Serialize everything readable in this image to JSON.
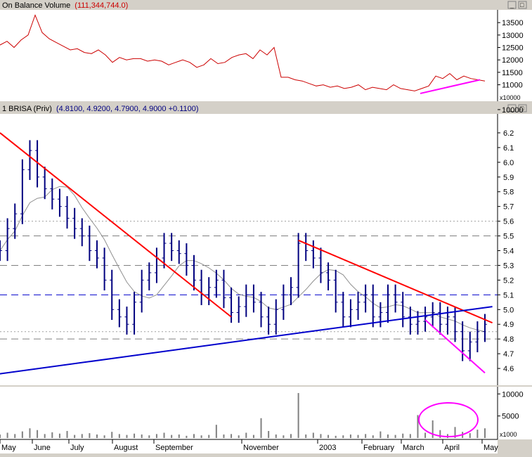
{
  "obv_panel": {
    "title": "On Balance Volume",
    "value": "(111,344,744.0)",
    "multiplier": "x10000"
  },
  "price_panel": {
    "title": "1 BRISA (Priv)",
    "values": "(4.8100, 4.9200, 4.7900, 4.9000 +0.1100)"
  },
  "volume_panel": {
    "multiplier": "x1000"
  },
  "window_buttons": {
    "minimize": "_",
    "maximize": "□"
  },
  "colors": {
    "background": "#ffffff",
    "frame": "#d4d0c8",
    "price_bars": "#00007f",
    "obv_line": "#cc0000",
    "down_trendline": "#ff0000",
    "up_trendline": "#0000cc",
    "divergence_marks": "#ff00ff",
    "title_blue": "#000080",
    "title_red": "#cc0000"
  },
  "chart_data": [
    {
      "type": "line",
      "name": "On Balance Volume",
      "y_axis_ticks": [
        13500,
        13000,
        12500,
        12000,
        11500,
        11000,
        10000
      ],
      "ylim": [
        10450,
        13900
      ],
      "series": [
        {
          "values": [
            12600,
            12750,
            12500,
            12800,
            13000,
            13800,
            13100,
            12850,
            12700,
            12550,
            12400,
            12450,
            12300,
            12250,
            12400,
            12200,
            11900,
            12100,
            12000,
            12050,
            12050,
            11950,
            12000,
            11950,
            11800,
            11900,
            12000,
            11900,
            11700,
            11800,
            12050,
            11850,
            11900,
            12100,
            12200,
            12250,
            12050,
            12400,
            12200,
            12500,
            11300,
            11300,
            11200,
            11150,
            11050,
            10950,
            11000,
            10900,
            10950,
            10850,
            10900,
            11000,
            10800,
            10900,
            10850,
            10800,
            11000,
            10850,
            10800,
            10750,
            10850,
            10950,
            11350,
            11250,
            11450,
            11200,
            11350,
            11250,
            11200,
            11150
          ]
        }
      ],
      "annotations": [
        {
          "type": "trendline",
          "color": "#ff00ff",
          "from": 10650,
          "to": 11200
        }
      ]
    },
    {
      "type": "bar",
      "name": "BRISA (Priv) price",
      "y_axis_ticks": [
        6.2,
        6.1,
        6.0,
        5.9,
        5.8,
        5.7,
        5.6,
        5.5,
        5.4,
        5.3,
        5.2,
        5.1,
        5.0,
        4.9,
        4.8,
        4.7,
        4.6
      ],
      "ylim": [
        4.5,
        6.3
      ],
      "x_labels": [
        "May",
        "June",
        "July",
        "August",
        "September",
        "November",
        "2003",
        "February",
        "March",
        "April",
        "May"
      ],
      "close": [
        5.4,
        5.55,
        5.65,
        5.95,
        6.08,
        5.9,
        5.82,
        5.75,
        5.7,
        5.62,
        5.55,
        5.5,
        5.4,
        5.35,
        5.2,
        5.0,
        4.95,
        4.9,
        5.05,
        5.2,
        5.25,
        5.35,
        5.45,
        5.4,
        5.38,
        5.3,
        5.2,
        5.1,
        5.15,
        5.2,
        5.08,
        4.98,
        5.02,
        5.1,
        5.05,
        4.95,
        4.9,
        5.0,
        5.1,
        5.15,
        5.45,
        5.4,
        5.35,
        5.25,
        5.2,
        5.05,
        4.95,
        5.0,
        5.05,
        5.1,
        4.95,
        4.98,
        5.1,
        5.05,
        4.95,
        4.9,
        4.92,
        4.95,
        4.98,
        4.9,
        4.95,
        4.85,
        4.72,
        4.78,
        4.85,
        4.9
      ],
      "horizontal_lines": [
        {
          "value": 5.5,
          "style": "dash"
        },
        {
          "value": 5.3,
          "style": "dash"
        },
        {
          "value": 5.1,
          "style": "blue-dash"
        },
        {
          "value": 4.8,
          "style": "dash"
        },
        {
          "value": 4.85,
          "style": "dot"
        },
        {
          "value": 5.6,
          "style": "dot"
        }
      ],
      "trendlines": [
        {
          "color": "#ff0000",
          "from": [
            0,
            6.2
          ],
          "to": [
            31,
            4.95
          ]
        },
        {
          "color": "#ff0000",
          "from": [
            40,
            5.47
          ],
          "to": [
            66,
            4.91
          ]
        },
        {
          "color": "#0000cc",
          "from": [
            -2,
            4.55
          ],
          "to": [
            66,
            5.02
          ]
        },
        {
          "color": "#ff00ff",
          "from": [
            57,
            4.93
          ],
          "to": [
            65,
            4.57
          ]
        }
      ]
    },
    {
      "type": "bar",
      "name": "Volume",
      "y_axis_ticks": [
        10000,
        5000
      ],
      "ylim": [
        0,
        11000
      ],
      "values": [
        800,
        1200,
        900,
        1500,
        2200,
        1800,
        900,
        1300,
        1000,
        1600,
        700,
        900,
        1100,
        800,
        600,
        1400,
        900,
        700,
        1000,
        800,
        600,
        900,
        1200,
        700,
        800,
        500,
        900,
        600,
        700,
        3000,
        800,
        900,
        600,
        1200,
        700,
        4500,
        1600,
        800,
        600,
        900,
        10200,
        800,
        1200,
        900,
        700,
        500,
        600,
        800,
        700,
        900,
        600,
        1500,
        800,
        700,
        1000,
        900,
        5200,
        1200,
        4000,
        1800,
        900,
        2500,
        1400,
        1100,
        1900,
        2200
      ],
      "annotations": [
        {
          "type": "ellipse",
          "color": "#ff00ff"
        }
      ]
    }
  ]
}
